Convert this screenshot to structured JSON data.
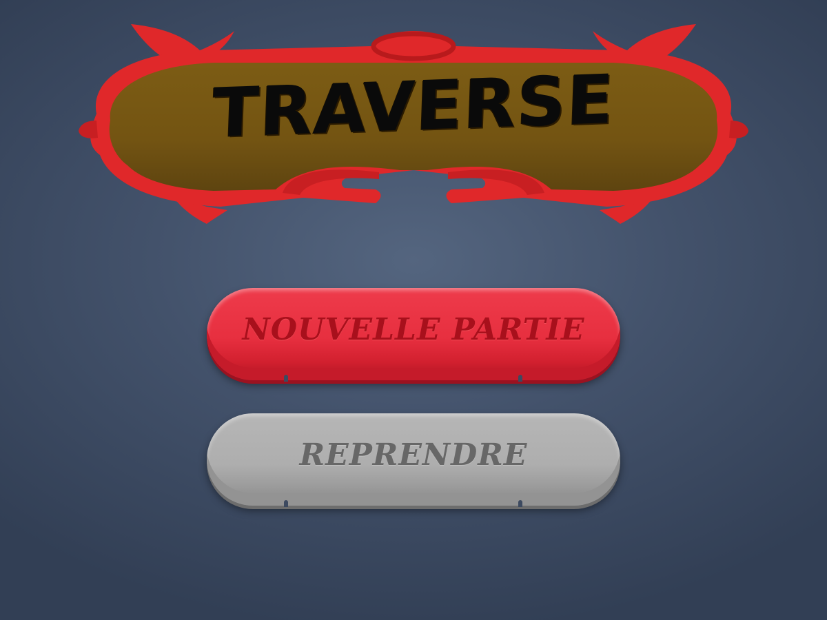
{
  "game": {
    "title": "TRAVERSE"
  },
  "menu": {
    "new_game_label": "NOUVELLE PARTIE",
    "resume_label": "REPRENDRE"
  },
  "colors": {
    "background": "#43526b",
    "banner_fill": "#7a5a14",
    "banner_frame": "#e0282a",
    "new_game_button": "#e72f3f",
    "resume_button": "#aeaeae"
  }
}
